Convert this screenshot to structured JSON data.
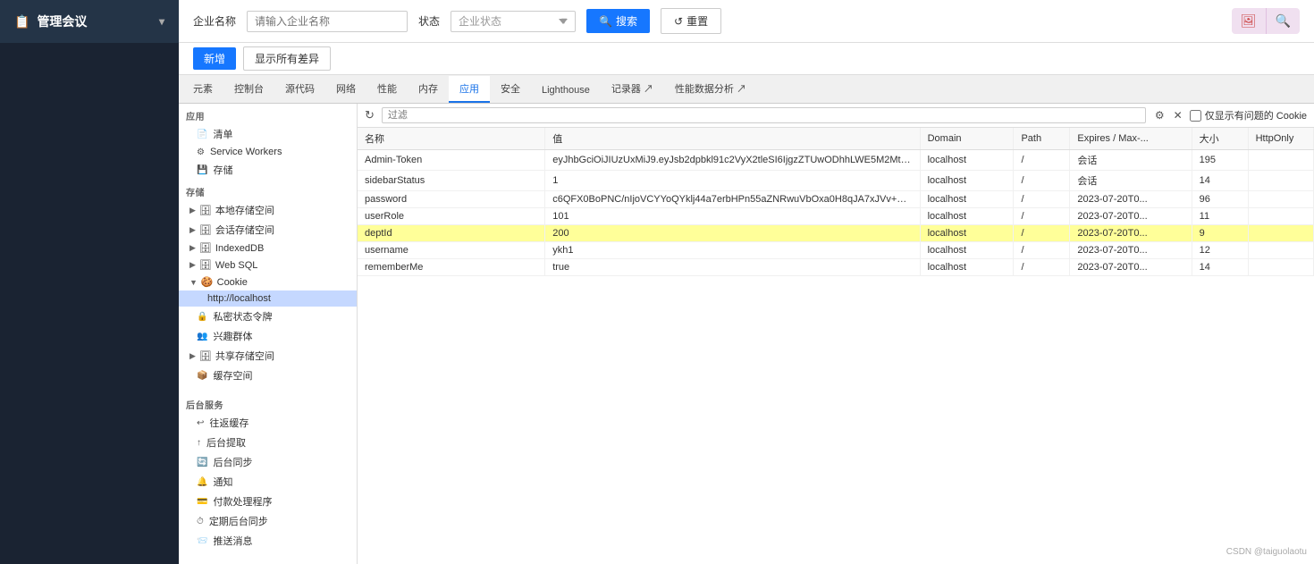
{
  "app": {
    "title": "管理会议",
    "title_icon": "📋"
  },
  "top_bar": {
    "company_label": "企业名称",
    "company_placeholder": "请输入企业名称",
    "status_label": "状态",
    "status_placeholder": "企业状态",
    "search_btn": "搜索",
    "reset_btn": "重置",
    "icon_btn1": "🖼",
    "icon_btn2": "🔍"
  },
  "sub_actions": {
    "btn1": "新增",
    "btn2": "显示所有差异"
  },
  "devtools": {
    "tabs": [
      {
        "label": "元素",
        "active": false
      },
      {
        "label": "控制台",
        "active": false
      },
      {
        "label": "源代码",
        "active": false
      },
      {
        "label": "网络",
        "active": false
      },
      {
        "label": "性能",
        "active": false
      },
      {
        "label": "内存",
        "active": false
      },
      {
        "label": "应用",
        "active": true
      },
      {
        "label": "安全",
        "active": false
      },
      {
        "label": "Lighthouse",
        "active": false
      },
      {
        "label": "记录器 ↗",
        "active": false
      },
      {
        "label": "性能数据分析 ↗",
        "active": false
      }
    ]
  },
  "sidebar": {
    "section_app": "应用",
    "items_app": [
      {
        "label": "清单",
        "icon": "📄"
      },
      {
        "label": "Service Workers",
        "icon": "⚙"
      },
      {
        "label": "存储",
        "icon": "💾"
      }
    ],
    "section_storage": "存储",
    "groups_storage": [
      {
        "label": "本地存储空间",
        "expanded": false,
        "icon": "🗄"
      },
      {
        "label": "会话存储空间",
        "expanded": false,
        "icon": "🗄"
      },
      {
        "label": "IndexedDB",
        "icon": "🗄"
      },
      {
        "label": "Web SQL",
        "icon": "🗄"
      },
      {
        "label": "Cookie",
        "expanded": true,
        "icon": "🍪",
        "children": [
          {
            "label": "http://localhost",
            "active": true
          }
        ]
      }
    ],
    "items_storage2": [
      {
        "label": "私密状态令牌",
        "icon": "🔒"
      },
      {
        "label": "兴趣群体",
        "icon": "👥"
      },
      {
        "label": "共享存储空间",
        "expanded": false,
        "icon": "🗄"
      },
      {
        "label": "缓存空间",
        "icon": "📦"
      }
    ],
    "section_backend": "后台服务",
    "items_backend": [
      {
        "label": "往返缓存",
        "icon": "↩"
      },
      {
        "label": "后台提取",
        "icon": "↑"
      },
      {
        "label": "后台同步",
        "icon": "🔄"
      },
      {
        "label": "通知",
        "icon": "🔔"
      },
      {
        "label": "付款处理程序",
        "icon": "💳"
      },
      {
        "label": "定期后台同步",
        "icon": "⏱"
      },
      {
        "label": "推送消息",
        "icon": "📨"
      }
    ]
  },
  "filter": {
    "placeholder": "过滤",
    "checkbox_label": "仅显示有问题的 Cookie"
  },
  "table": {
    "columns": [
      "名称",
      "值",
      "Domain",
      "Path",
      "Expires / Max-...",
      "大小",
      "HttpOnly"
    ],
    "col_widths": [
      "200px",
      "auto",
      "100px",
      "60px",
      "130px",
      "60px",
      "70px"
    ],
    "rows": [
      {
        "name": "Admin-Token",
        "value": "eyJhbGciOiJIUzUxMiJ9.eyJsb2dpbkl91c2VyX2tleSI6IjgzZTUwODhhLWE5M2MtNGUyZC1i...",
        "domain": "localhost",
        "path": "/",
        "expires": "会话",
        "size": "195",
        "httponly": "",
        "highlighted": false
      },
      {
        "name": "sidebarStatus",
        "value": "1",
        "domain": "localhost",
        "path": "/",
        "expires": "会话",
        "size": "14",
        "httponly": "",
        "highlighted": false
      },
      {
        "name": "password",
        "value": "c6QFX0BoPNC/nIjoVCYYoQYklj44a7erbHPn55aZNRwuVbOxa0H8qJA7xJVv+OIz/jWRXK...",
        "domain": "localhost",
        "path": "/",
        "expires": "2023-07-20T0...",
        "size": "96",
        "httponly": "",
        "highlighted": false
      },
      {
        "name": "userRole",
        "value": "101",
        "domain": "localhost",
        "path": "/",
        "expires": "2023-07-20T0...",
        "size": "11",
        "httponly": "",
        "highlighted": false
      },
      {
        "name": "deptId",
        "value": "200",
        "domain": "localhost",
        "path": "/",
        "expires": "2023-07-20T0...",
        "size": "9",
        "httponly": "",
        "highlighted": true
      },
      {
        "name": "username",
        "value": "ykh1",
        "domain": "localhost",
        "path": "/",
        "expires": "2023-07-20T0...",
        "size": "12",
        "httponly": "",
        "highlighted": false
      },
      {
        "name": "rememberMe",
        "value": "true",
        "domain": "localhost",
        "path": "/",
        "expires": "2023-07-20T0...",
        "size": "14",
        "httponly": "",
        "highlighted": false
      }
    ]
  },
  "watermark": "CSDN @taiguolaotu"
}
